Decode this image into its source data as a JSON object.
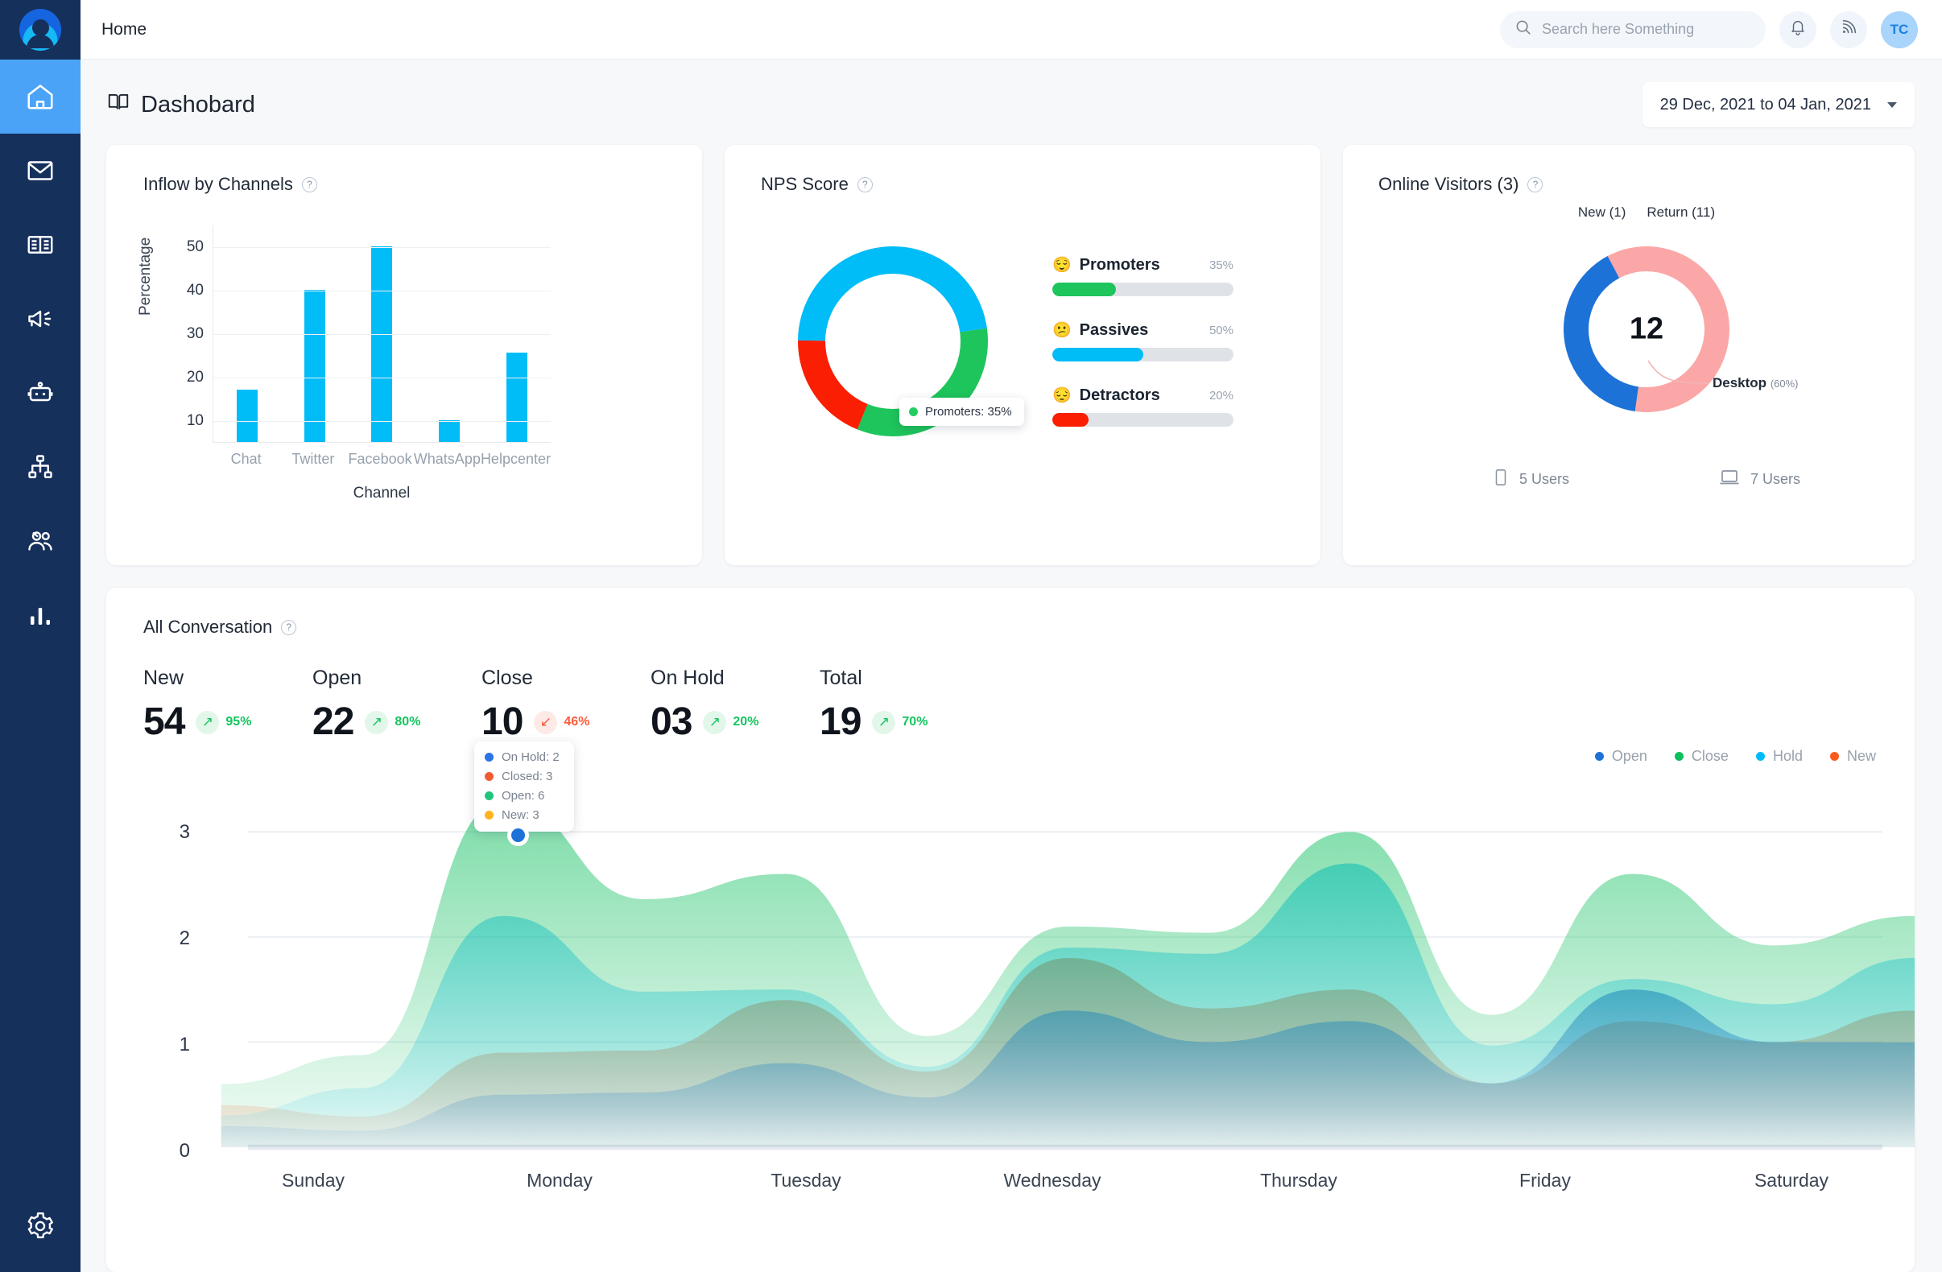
{
  "sidebar": {
    "logo_name": "app-logo",
    "items": [
      {
        "id": "home",
        "icon": "home-icon",
        "active": true
      },
      {
        "id": "inbox",
        "icon": "mail-icon",
        "active": false
      },
      {
        "id": "knowledge",
        "icon": "book-icon",
        "active": false
      },
      {
        "id": "campaigns",
        "icon": "megaphone-icon",
        "active": false
      },
      {
        "id": "bots",
        "icon": "robot-icon",
        "active": false
      },
      {
        "id": "workflows",
        "icon": "sitemap-icon",
        "active": false
      },
      {
        "id": "contacts",
        "icon": "users-icon",
        "active": false
      },
      {
        "id": "reports",
        "icon": "bar-chart-icon",
        "active": false
      }
    ],
    "bottom": {
      "id": "settings",
      "icon": "gear-icon"
    }
  },
  "topbar": {
    "breadcrumb": "Home",
    "search_placeholder": "Search here Something",
    "search_value": "",
    "notification_icon": "bell-icon",
    "broadcast_icon": "rss-icon",
    "avatar_initials": "TC"
  },
  "pagehead": {
    "title": "Dashobard",
    "title_icon": "book-open-icon",
    "date_range": "29 Dec, 2021 to 04 Jan, 2021"
  },
  "inflow": {
    "title": "Inflow by Channels",
    "help_icon": "question-icon"
  },
  "nps": {
    "title": "NPS Score",
    "help_icon": "question-icon",
    "tooltip": "Promoters: 35%",
    "tooltip_color": "#25cc62",
    "legend": [
      {
        "name": "Promoters",
        "pct": "35%",
        "value": 35,
        "color": "#1ec45c",
        "emoji": "😌"
      },
      {
        "name": "Passives",
        "pct": "50%",
        "value": 50,
        "color": "#00bcf7",
        "emoji": "😕"
      },
      {
        "name": "Detractors",
        "pct": "20%",
        "value": 20,
        "color": "#fa1e02",
        "emoji": "😔"
      }
    ]
  },
  "visitors": {
    "title": "Online Visitors (3)",
    "help_icon": "question-icon",
    "legend": [
      "New (1)",
      "Return (11)"
    ],
    "center_value": "12",
    "callout_label": "Desktop",
    "callout_pct": "(60%)",
    "mobile_users": "5 Users",
    "desktop_users": "7 Users",
    "mobile_icon": "phone-icon",
    "desktop_icon": "laptop-icon"
  },
  "conversation": {
    "title": "All Conversation",
    "help_icon": "question-icon",
    "stats": [
      {
        "label": "New",
        "value": "54",
        "delta": "95%",
        "dir": "up"
      },
      {
        "label": "Open",
        "value": "22",
        "delta": "80%",
        "dir": "up"
      },
      {
        "label": "Close",
        "value": "10",
        "delta": "46%",
        "dir": "down"
      },
      {
        "label": "On Hold",
        "value": "03",
        "delta": "20%",
        "dir": "up"
      },
      {
        "label": "Total",
        "value": "19",
        "delta": "70%",
        "dir": "up"
      }
    ],
    "legend": [
      {
        "label": "Open",
        "color": "#1d72d8"
      },
      {
        "label": "Close",
        "color": "#0fbf5f"
      },
      {
        "label": "Hold",
        "color": "#00bcf7"
      },
      {
        "label": "New",
        "color": "#fa5a1e"
      }
    ],
    "tooltip": [
      {
        "label": "On Hold: 2",
        "color": "#2a73e8"
      },
      {
        "label": "Closed: 3",
        "color": "#f05a32"
      },
      {
        "label": "Open: 6",
        "color": "#21c47c"
      },
      {
        "label": "New: 3",
        "color": "#ffb320"
      }
    ]
  },
  "chart_data": [
    {
      "type": "bar",
      "title": "Inflow by Channels",
      "xlabel": "Channel",
      "ylabel": "Percentage",
      "categories": [
        "Chat",
        "Twitter",
        "Facebook",
        "WhatsApp",
        "Helpcenter"
      ],
      "values": [
        17,
        40,
        50,
        10,
        25.5
      ],
      "yticks": [
        10,
        20,
        30,
        40,
        50
      ],
      "ylim": [
        5,
        55
      ],
      "color": "#00bcf7",
      "grid": true,
      "legend": "none"
    },
    {
      "type": "pie",
      "title": "NPS Score",
      "labels": [
        "Promoters",
        "Passives",
        "Detractors"
      ],
      "values": [
        35,
        50,
        20
      ],
      "colors": [
        "#1ec45c",
        "#00bcf7",
        "#fa1e02"
      ],
      "donut": true,
      "annotation": "Promoters: 35%"
    },
    {
      "type": "pie",
      "title": "Online Visitors (3)",
      "labels": [
        "Desktop",
        "Mobile"
      ],
      "values": [
        60,
        40
      ],
      "colors": [
        "#fba7a7",
        "#1d72d8"
      ],
      "donut": true,
      "center_label": "12",
      "annotations": [
        "New (1)",
        "Return (11)",
        "Desktop (60%)"
      ]
    },
    {
      "type": "area",
      "title": "All Conversation",
      "x": [
        "Sunday",
        "Monday",
        "Tuesday",
        "Wednesday",
        "Thursday",
        "Friday",
        "Saturday"
      ],
      "yticks": [
        0,
        1,
        2,
        3
      ],
      "ylim": [
        0,
        3.6
      ],
      "grid": true,
      "legend_position": "top-right",
      "series": [
        {
          "name": "Open",
          "color": "#1d72d8",
          "values": [
            0.2,
            0.5,
            0.8,
            1.3,
            1.2,
            1.5,
            1.0
          ]
        },
        {
          "name": "Close",
          "color": "#0fbf5f",
          "values": [
            0.6,
            3.3,
            2.6,
            2.1,
            3.0,
            2.6,
            2.2
          ]
        },
        {
          "name": "Hold",
          "color": "#00bcf7",
          "values": [
            0.3,
            2.2,
            1.5,
            1.9,
            2.7,
            1.6,
            1.8
          ]
        },
        {
          "name": "New",
          "color": "#fa5a1e",
          "values": [
            0.4,
            0.9,
            1.4,
            1.8,
            1.5,
            1.2,
            1.3
          ]
        }
      ],
      "hover": {
        "x": "Monday",
        "values": [
          "On Hold: 2",
          "Closed: 3",
          "Open: 6",
          "New: 3"
        ]
      }
    }
  ]
}
